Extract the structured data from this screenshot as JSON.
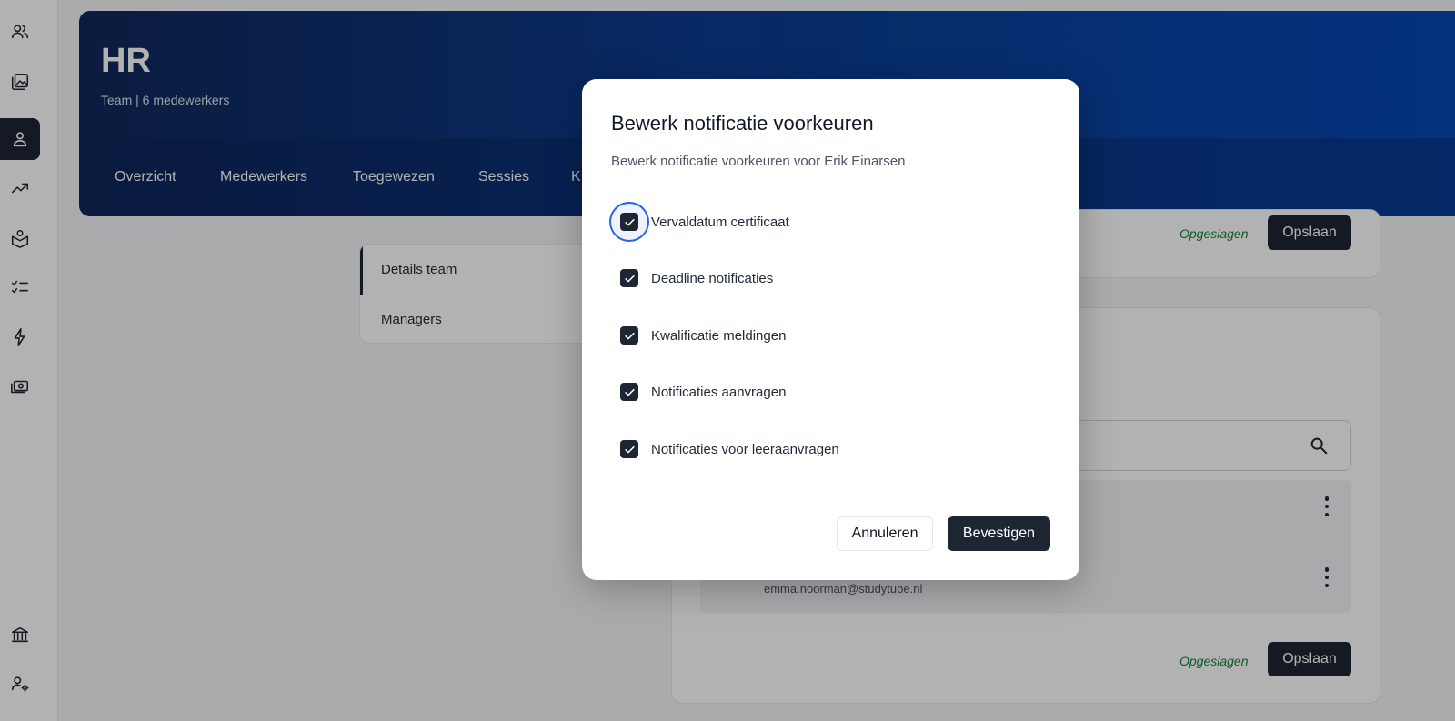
{
  "sidebar": {
    "items": [
      {
        "icon": "users-icon"
      },
      {
        "icon": "gallery-icon"
      },
      {
        "icon": "user-icon",
        "active": true
      },
      {
        "icon": "trending-icon"
      },
      {
        "icon": "book-icon"
      },
      {
        "icon": "checklist-icon"
      },
      {
        "icon": "lightning-icon"
      },
      {
        "icon": "money-icon"
      },
      {
        "icon": "bank-icon"
      },
      {
        "icon": "user-settings-icon"
      }
    ]
  },
  "header": {
    "title": "HR",
    "subtitle": "Team | 6 medewerkers",
    "tabs": [
      "Overzicht",
      "Medewerkers",
      "Toegewezen",
      "Sessies",
      "K"
    ]
  },
  "side_nav": {
    "items": [
      "Details team",
      "Managers"
    ]
  },
  "details_card": {
    "saved_text": "Opgeslagen",
    "save_label": "Opslaan"
  },
  "managers_card": {
    "email": "emma.noorman@studytube.nl",
    "saved_text": "Opgeslagen",
    "save_label": "Opslaan"
  },
  "modal": {
    "title": "Bewerk notificatie voorkeuren",
    "description": "Bewerk notificatie voorkeuren voor Erik Einarsen",
    "options": [
      {
        "label": "Vervaldatum certificaat",
        "checked": true
      },
      {
        "label": "Deadline notificaties",
        "checked": true
      },
      {
        "label": "Kwalificatie meldingen",
        "checked": true
      },
      {
        "label": "Notificaties aanvragen",
        "checked": true
      },
      {
        "label": "Notificaties voor leeraanvragen",
        "checked": true
      }
    ],
    "cancel_label": "Annuleren",
    "confirm_label": "Bevestigen"
  },
  "colors": {
    "primary_dark": "#1e2533",
    "header_gradient_start": "#11285a",
    "header_gradient_end": "#0748b4",
    "saved_green": "#15803d",
    "focus_ring": "#2563eb"
  }
}
